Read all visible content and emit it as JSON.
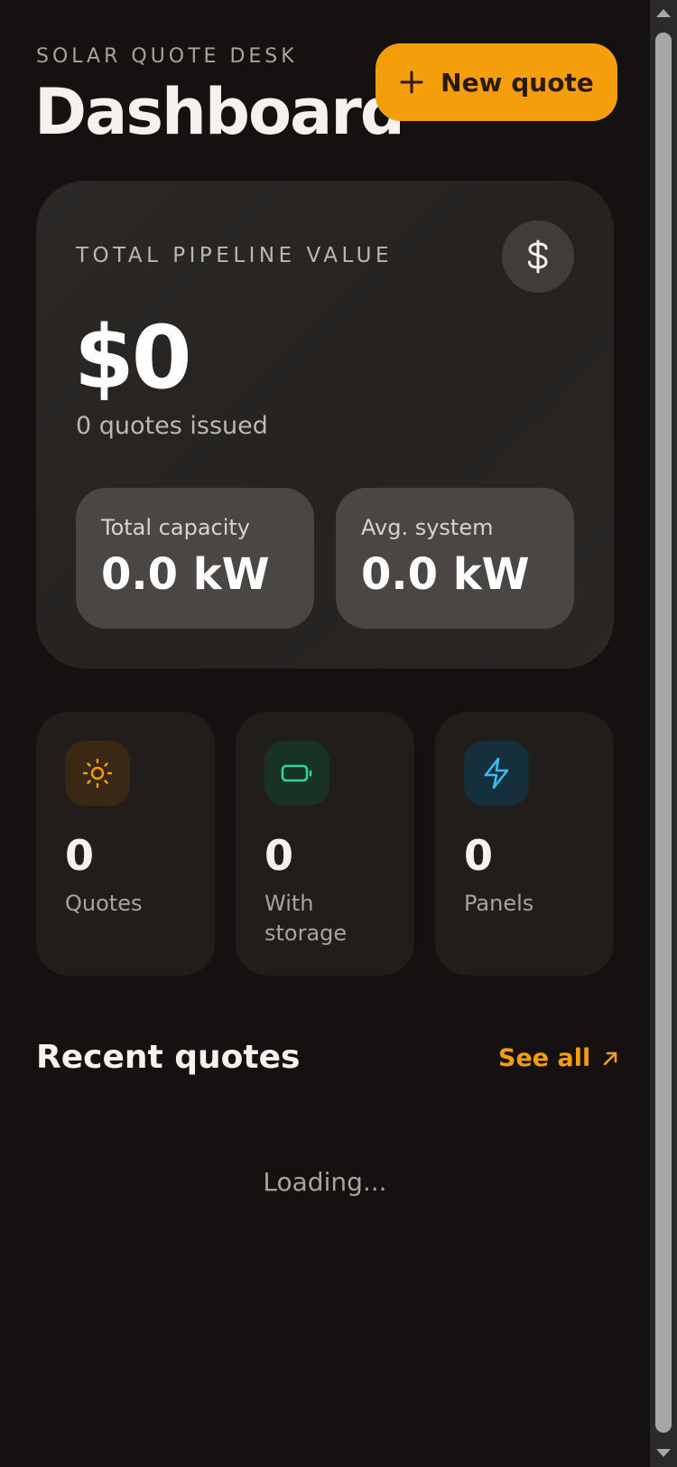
{
  "header": {
    "eyebrow": "SOLAR QUOTE DESK",
    "title": "Dashboard",
    "new_quote_label": "New quote",
    "new_quote_icon": "plus-icon"
  },
  "pipeline": {
    "label": "TOTAL PIPELINE VALUE",
    "icon": "dollar-icon",
    "value": "$0",
    "subtitle": "0 quotes issued",
    "total_capacity": {
      "label": "Total capacity",
      "value": "0.0 kW"
    },
    "avg_system": {
      "label": "Avg. system",
      "value": "0.0 kW"
    }
  },
  "stats": [
    {
      "icon": "sun-icon",
      "value": "0",
      "label": "Quotes",
      "accent": "#f59e0b",
      "tint": "#3a2815"
    },
    {
      "icon": "battery-icon",
      "value": "0",
      "label": "With storage",
      "accent": "#34d399",
      "tint": "#183326"
    },
    {
      "icon": "lightning-icon",
      "value": "0",
      "label": "Panels",
      "accent": "#38bdf8",
      "tint": "#15303c"
    }
  ],
  "recent": {
    "title": "Recent quotes",
    "see_all_label": "See all",
    "see_all_icon": "arrow-up-right-icon",
    "loading_text": "Loading..."
  },
  "colors": {
    "background": "#141110",
    "accent": "#f59e0b",
    "card": "#201d1a"
  }
}
